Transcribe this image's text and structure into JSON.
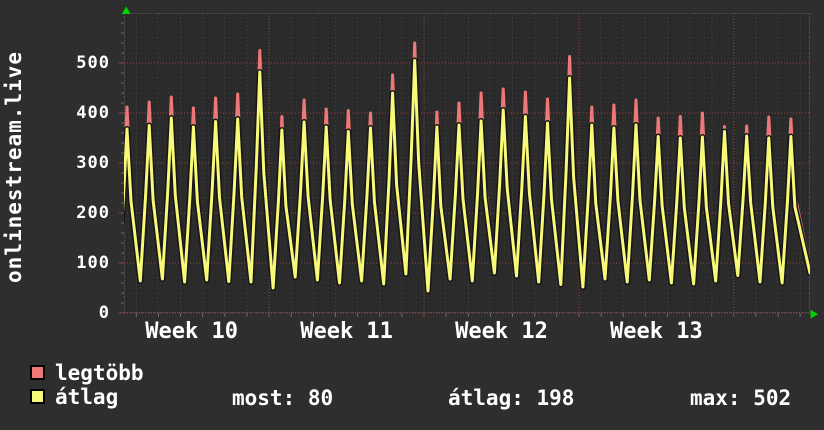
{
  "watermark": "onlinestream.live",
  "legend": {
    "series": [
      {
        "label": "legtöbb",
        "color": "#ee7878"
      },
      {
        "label": "átlag",
        "color": "#f8f879"
      }
    ]
  },
  "stats": {
    "items": [
      {
        "label": "most:",
        "value": "80"
      },
      {
        "label": "átlag:",
        "value": "198"
      },
      {
        "label": "max:",
        "value": "502"
      }
    ]
  },
  "chart_data": {
    "type": "line",
    "title": "onlinestream.live",
    "xlabel": "",
    "ylabel": "",
    "ylim": [
      0,
      600
    ],
    "y_ticks": [
      0,
      100,
      200,
      300,
      400,
      500
    ],
    "x_tick_labels": [
      "Week 10",
      "Week 11",
      "Week 12",
      "Week 13"
    ],
    "grid": "on",
    "legend_position": "bottom-left",
    "colors": {
      "background": "#2e2e2e",
      "plot_background": "#2a2a2a",
      "major_grid_red": "#9e4242",
      "minor_grid_gray": "#3b3b3b",
      "day_grid_gray": "#484848",
      "axis_arrow_green": "#00d400",
      "series_legtobb": "#ee7878",
      "series_atlag": "#f8f879",
      "atlag_outline": "#161616",
      "text": "#ffffff"
    },
    "x_axis_description": "time, ~31 daily cycles spanning Week 10 .. Week 13 (week gridlines every 7 days)",
    "day_columns": [
      "trough_legtobb",
      "trough_atlag",
      "peak_legtobb",
      "peak_atlag"
    ],
    "days": [
      [
        75,
        68,
        412,
        368
      ],
      [
        72,
        64,
        422,
        375
      ],
      [
        78,
        68,
        432,
        390
      ],
      [
        70,
        62,
        410,
        372
      ],
      [
        75,
        66,
        430,
        383
      ],
      [
        72,
        63,
        438,
        388
      ],
      [
        70,
        62,
        525,
        482
      ],
      [
        58,
        50,
        393,
        366
      ],
      [
        80,
        72,
        426,
        382
      ],
      [
        76,
        66,
        408,
        372
      ],
      [
        70,
        60,
        405,
        363
      ],
      [
        74,
        64,
        400,
        370
      ],
      [
        68,
        58,
        476,
        440
      ],
      [
        88,
        78,
        540,
        505
      ],
      [
        52,
        44,
        402,
        372
      ],
      [
        78,
        68,
        420,
        376
      ],
      [
        74,
        64,
        440,
        384
      ],
      [
        90,
        80,
        448,
        406
      ],
      [
        84,
        74,
        442,
        393
      ],
      [
        70,
        62,
        428,
        380
      ],
      [
        65,
        57,
        513,
        470
      ],
      [
        60,
        52,
        412,
        376
      ],
      [
        78,
        68,
        416,
        370
      ],
      [
        72,
        62,
        426,
        376
      ],
      [
        76,
        66,
        390,
        353
      ],
      [
        70,
        60,
        393,
        350
      ],
      [
        68,
        58,
        400,
        352
      ],
      [
        74,
        64,
        373,
        363
      ],
      [
        85,
        75,
        374,
        354
      ],
      [
        72,
        62,
        392,
        350
      ],
      [
        70,
        60,
        388,
        353
      ]
    ],
    "end_values": {
      "legtobb": 92,
      "atlag": 80
    },
    "series": [
      {
        "name": "legtöbb",
        "role": "daily maximum line",
        "color": "#ee7878"
      },
      {
        "name": "átlag",
        "role": "daily average line",
        "color": "#f8f879",
        "stats": {
          "most": 80,
          "atlag": 198,
          "max": 502
        }
      }
    ]
  }
}
